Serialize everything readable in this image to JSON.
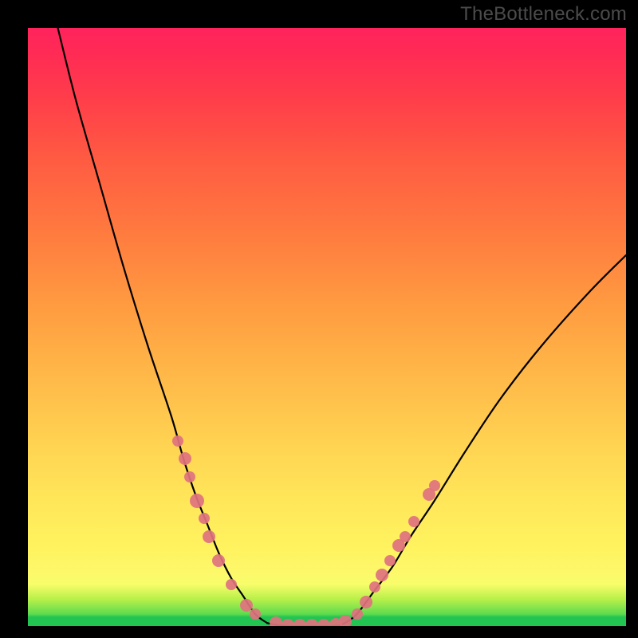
{
  "watermark": "TheBottleneck.com",
  "colors": {
    "marker": "#e0727f",
    "curve": "#000000",
    "background_top": "#ff235c",
    "background_bottom": "#22c552",
    "frame": "#000000"
  },
  "chart_data": {
    "type": "line",
    "title": "",
    "xlabel": "",
    "ylabel": "",
    "xlim": [
      0,
      100
    ],
    "ylim": [
      0,
      100
    ],
    "series": [
      {
        "name": "left-curve",
        "x": [
          5,
          8,
          12,
          16,
          20,
          24,
          26,
          28,
          30,
          32,
          34,
          36,
          38,
          40
        ],
        "y": [
          100,
          88,
          74,
          60,
          47,
          35,
          28,
          22,
          17,
          12,
          8,
          5,
          2,
          0.5
        ]
      },
      {
        "name": "right-curve",
        "x": [
          53,
          55,
          58,
          61,
          64,
          68,
          73,
          79,
          86,
          94,
          100
        ],
        "y": [
          0.5,
          2,
          6,
          10,
          15,
          21,
          29,
          38,
          47,
          56,
          62
        ]
      },
      {
        "name": "valley-floor",
        "x": [
          40,
          42,
          44,
          46,
          48,
          50,
          52,
          53
        ],
        "y": [
          0.5,
          0.1,
          0,
          0,
          0,
          0,
          0.1,
          0.5
        ]
      }
    ],
    "markers_left": {
      "name": "left-markers",
      "points": [
        {
          "x": 25.0,
          "y": 31,
          "r": 7
        },
        {
          "x": 26.2,
          "y": 28,
          "r": 8
        },
        {
          "x": 27.0,
          "y": 25,
          "r": 7
        },
        {
          "x": 28.2,
          "y": 21,
          "r": 9
        },
        {
          "x": 29.4,
          "y": 18,
          "r": 7
        },
        {
          "x": 30.2,
          "y": 15,
          "r": 8
        },
        {
          "x": 31.8,
          "y": 11,
          "r": 8
        },
        {
          "x": 34.0,
          "y": 7,
          "r": 7
        },
        {
          "x": 36.5,
          "y": 3.5,
          "r": 8
        },
        {
          "x": 38.0,
          "y": 2.0,
          "r": 7
        }
      ]
    },
    "markers_right": {
      "name": "right-markers",
      "points": [
        {
          "x": 55.0,
          "y": 2.0,
          "r": 7
        },
        {
          "x": 56.5,
          "y": 4.0,
          "r": 8
        },
        {
          "x": 58.0,
          "y": 6.5,
          "r": 7
        },
        {
          "x": 59.2,
          "y": 8.5,
          "r": 8
        },
        {
          "x": 60.5,
          "y": 11.0,
          "r": 7
        },
        {
          "x": 62.0,
          "y": 13.5,
          "r": 8
        },
        {
          "x": 63.0,
          "y": 15.0,
          "r": 7
        },
        {
          "x": 64.5,
          "y": 17.5,
          "r": 7
        },
        {
          "x": 67.0,
          "y": 22.0,
          "r": 8
        },
        {
          "x": 68.0,
          "y": 23.5,
          "r": 7
        }
      ]
    },
    "markers_floor": {
      "name": "floor-markers",
      "points": [
        {
          "x": 41.5,
          "y": 0.5,
          "r": 8
        },
        {
          "x": 43.5,
          "y": 0.2,
          "r": 8
        },
        {
          "x": 45.5,
          "y": 0.2,
          "r": 8
        },
        {
          "x": 47.5,
          "y": 0.2,
          "r": 8
        },
        {
          "x": 49.5,
          "y": 0.2,
          "r": 8
        },
        {
          "x": 51.5,
          "y": 0.3,
          "r": 8
        },
        {
          "x": 53.0,
          "y": 0.8,
          "r": 8
        }
      ]
    }
  }
}
